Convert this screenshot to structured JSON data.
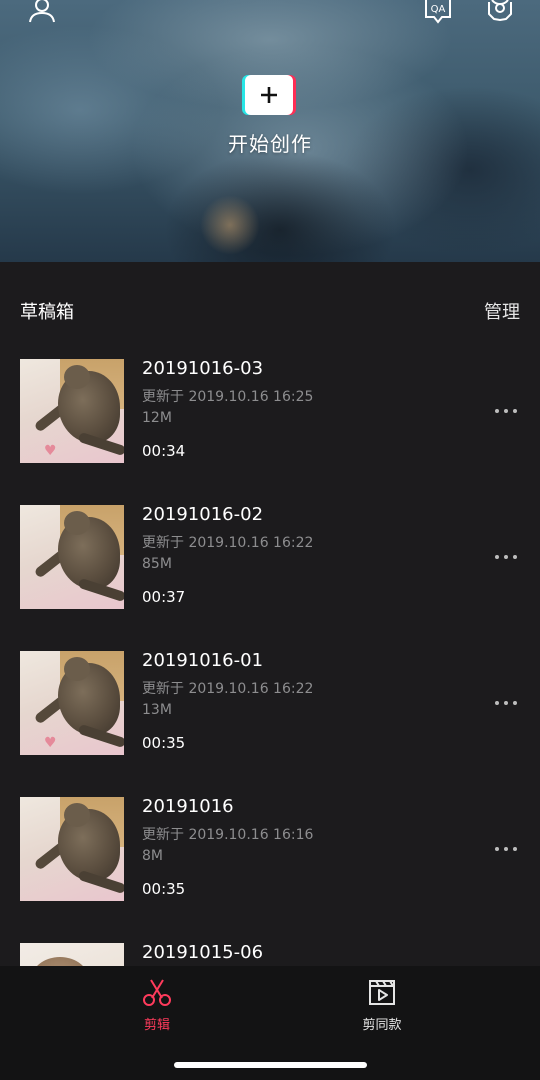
{
  "header": {
    "icons": [
      "user-icon",
      "qa-icon",
      "gear-icon"
    ],
    "qa_icon_text": "QA",
    "create_label": "开始创作"
  },
  "drafts": {
    "title": "草稿箱",
    "manage_label": "管理",
    "items": [
      {
        "name": "20191016-03",
        "updated": "更新于 2019.10.16 16:25",
        "size": "12M",
        "duration": "00:34"
      },
      {
        "name": "20191016-02",
        "updated": "更新于 2019.10.16 16:22",
        "size": "85M",
        "duration": "00:37"
      },
      {
        "name": "20191016-01",
        "updated": "更新于 2019.10.16 16:22",
        "size": "13M",
        "duration": "00:35"
      },
      {
        "name": "20191016",
        "updated": "更新于 2019.10.16 16:16",
        "size": "8M",
        "duration": "00:35"
      },
      {
        "name": "20191015-06",
        "updated": "",
        "size": "",
        "duration": ""
      }
    ]
  },
  "tabbar": {
    "tabs": [
      {
        "label": "剪辑",
        "icon": "scissors-icon",
        "active": true
      },
      {
        "label": "剪同款",
        "icon": "clapperboard-icon",
        "active": false
      }
    ]
  },
  "colors": {
    "accent": "#ff3b5c",
    "background": "#1c1b1d",
    "secondary_text": "#8d8d8f"
  }
}
